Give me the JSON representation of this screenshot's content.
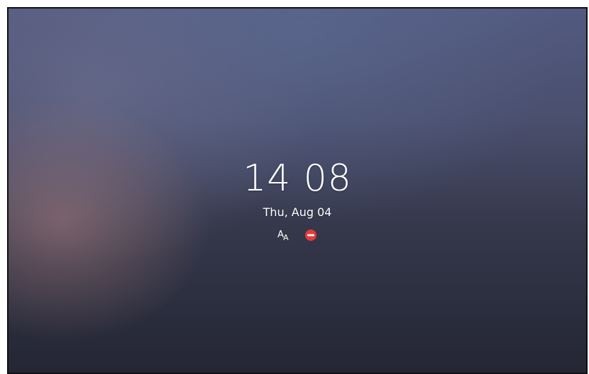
{
  "lock_screen": {
    "time": "14 08",
    "date": "Thu, Aug 04",
    "icons": {
      "font_size": "font-size-icon",
      "do_not_disturb": "do-not-disturb-icon"
    }
  },
  "colors": {
    "text": "#ffffff",
    "dnd_red": "#e5393a"
  }
}
